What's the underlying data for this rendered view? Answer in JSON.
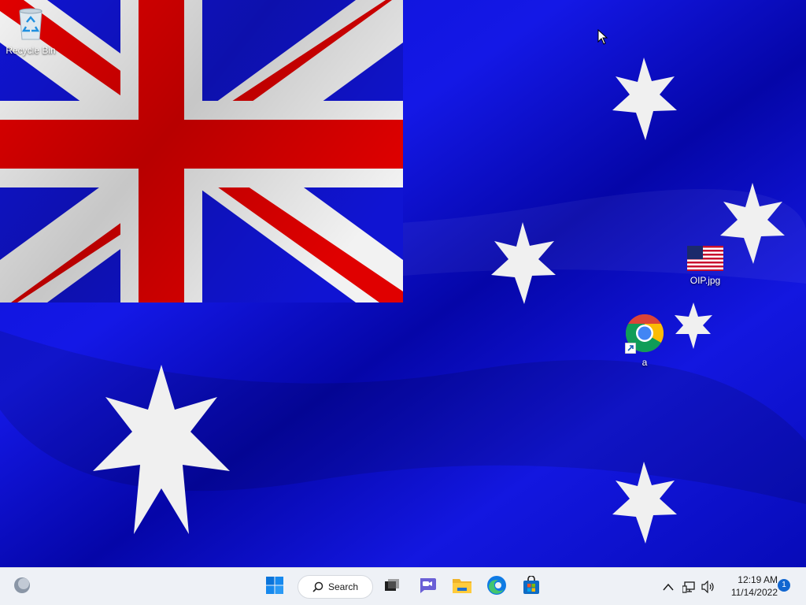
{
  "desktop": {
    "icons": [
      {
        "label": "Recycle Bin",
        "icon": "recycle-bin-icon"
      },
      {
        "label": "OIP.jpg",
        "icon": "image-file-icon"
      },
      {
        "label": "a",
        "icon": "chrome-shortcut-icon"
      }
    ],
    "wallpaper": "australian-flag"
  },
  "taskbar": {
    "widgets_icon": "weather-widget-icon",
    "start_icon": "windows-start-icon",
    "search_label": "Search",
    "apps": [
      {
        "name": "task-view",
        "icon": "task-view-icon"
      },
      {
        "name": "chat",
        "icon": "teams-chat-icon"
      },
      {
        "name": "file-explorer",
        "icon": "folder-icon"
      },
      {
        "name": "edge",
        "icon": "edge-icon"
      },
      {
        "name": "store",
        "icon": "store-icon"
      }
    ],
    "tray": {
      "overflow_icon": "chevron-up-icon",
      "network_icon": "network-icon",
      "volume_icon": "volume-icon"
    },
    "clock": {
      "time": "12:19 AM",
      "date": "11/14/2022"
    },
    "notification_count": "1"
  },
  "colors": {
    "flag_blue": "#0b10d8",
    "flag_red": "#e00000",
    "taskbar_bg": "#eef1f6",
    "accent": "#1166d0"
  }
}
